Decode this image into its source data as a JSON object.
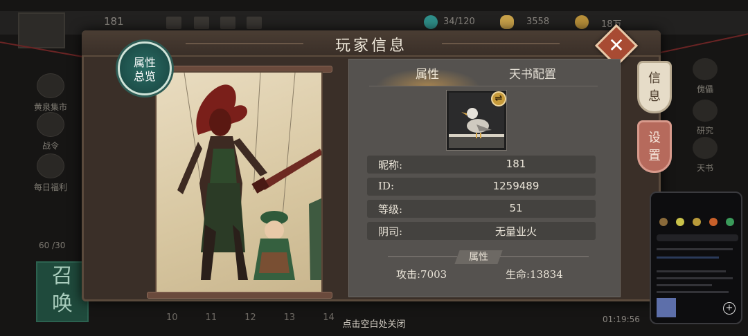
{
  "background": {
    "player_level_label": "181",
    "stamina": "60 /30",
    "resources": [
      {
        "name": "jade",
        "value": "34/120",
        "color": "#2f8f8a"
      },
      {
        "name": "gold-ingot",
        "value": "3558",
        "color": "#c9a24a"
      },
      {
        "name": "coin",
        "value": "18万",
        "color": "#b8903a"
      }
    ],
    "left_menu": [
      "黄泉集市",
      "战令",
      "每日福利"
    ],
    "right_menu": [
      "傀儡",
      "研究",
      "天书"
    ],
    "summon_label": "召唤",
    "timeline": [
      "10",
      "11",
      "12",
      "13",
      "14"
    ],
    "clock": "01:19:56"
  },
  "dialog": {
    "title": "玩家信息",
    "tag": "属性总览",
    "tabs": [
      {
        "label": "属性",
        "active": true
      },
      {
        "label": "天书配置",
        "active": false
      }
    ],
    "swap_icon": "swap-icon",
    "fields": [
      {
        "key": "昵称:",
        "value": "181"
      },
      {
        "key": "ID:",
        "value": "1259489"
      },
      {
        "key": "等级:",
        "value": "51"
      },
      {
        "key": "阴司:",
        "value": "无量业火"
      }
    ],
    "attr_section": "属性",
    "stats": {
      "attack": "攻击:7003",
      "hp": "生命:13834"
    },
    "side_tabs": {
      "info": "信息",
      "settings": "设置"
    },
    "close_icon": "close-icon"
  },
  "footer_hint": "点击空白处关闭",
  "colors": {
    "accent_close": "#a84b33",
    "tag_teal": "#1d4f4a",
    "panel": "#55524f"
  }
}
